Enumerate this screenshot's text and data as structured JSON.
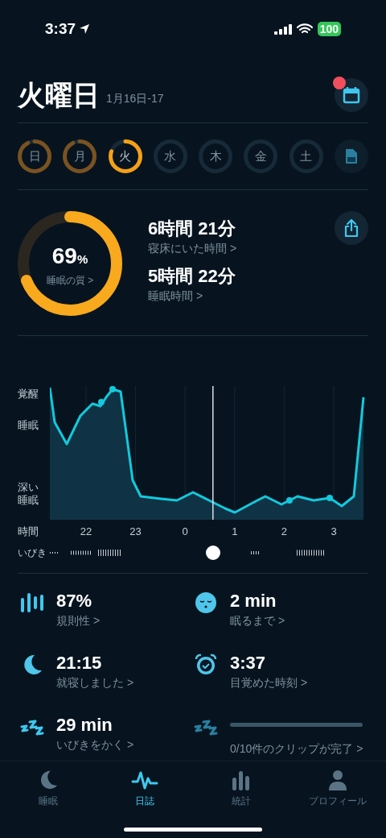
{
  "status_bar": {
    "time": "3:37",
    "battery": "100"
  },
  "header": {
    "title": "火曜日",
    "date_range": "1月16日-17",
    "notification": true
  },
  "days": [
    {
      "label": "日",
      "recorded": true,
      "selected": false
    },
    {
      "label": "月",
      "recorded": true,
      "selected": false
    },
    {
      "label": "火",
      "recorded": true,
      "selected": true
    },
    {
      "label": "水",
      "recorded": false,
      "selected": false
    },
    {
      "label": "木",
      "recorded": false,
      "selected": false
    },
    {
      "label": "金",
      "recorded": false,
      "selected": false
    },
    {
      "label": "土",
      "recorded": false,
      "selected": false
    }
  ],
  "summary": {
    "score": "69",
    "score_unit": "%",
    "score_label": "睡眠の質 >",
    "level": 0.69,
    "metrics": [
      {
        "value": "6時間 21分",
        "label": "寝床にいた時間 >"
      },
      {
        "value": "5時間 22分",
        "label": "睡眠時間 >"
      }
    ]
  },
  "sleep_graph": {
    "y_labels": [
      "覚醒",
      "睡眠",
      "深い",
      "睡眠"
    ],
    "x_title": "時間",
    "x_labels": [
      "22",
      "23",
      "0",
      "1",
      "2",
      "3"
    ],
    "snore_label": "いびき"
  },
  "stats": [
    {
      "kind": "regularity",
      "value": "87%",
      "label": "規則性 >"
    },
    {
      "kind": "fall_asleep",
      "value": "2 min",
      "label": "眠るまで >"
    },
    {
      "kind": "bedtime",
      "value": "21:15",
      "label": "就寝しました >"
    },
    {
      "kind": "wakeup",
      "value": "3:37",
      "label": "目覚めた時刻 >"
    },
    {
      "kind": "snoring",
      "value": "29 min",
      "label": "いびきをかく >"
    },
    {
      "kind": "clips",
      "label": "0/10件のクリップが完了 >"
    }
  ],
  "tabs": [
    {
      "label": "睡眠",
      "kind": "moon",
      "selected": false
    },
    {
      "label": "日誌",
      "kind": "wave",
      "selected": true
    },
    {
      "label": "統計",
      "kind": "bars",
      "selected": false
    },
    {
      "label": "プロフィール",
      "kind": "person",
      "selected": false
    }
  ]
}
